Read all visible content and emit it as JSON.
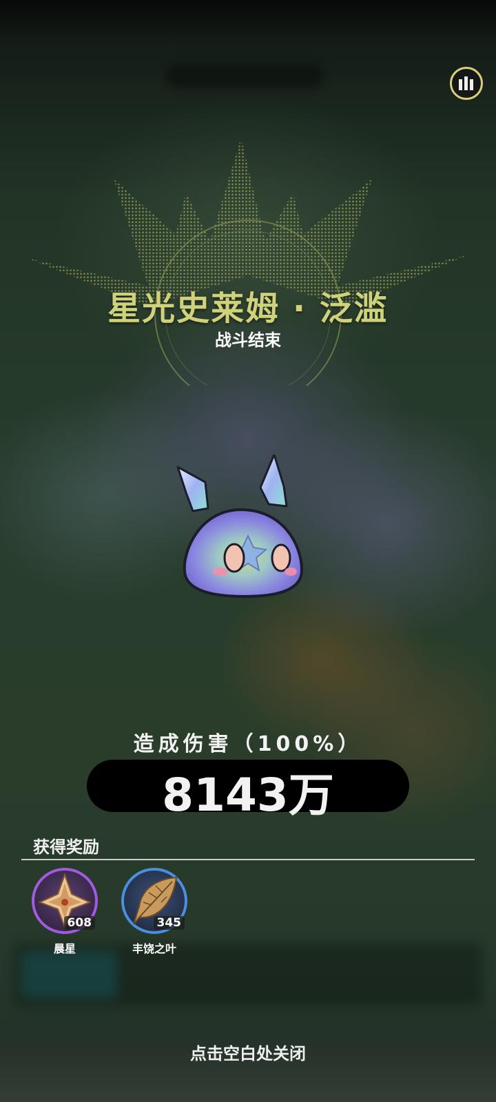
{
  "boss": {
    "title": "星光史莱姆 · 泛滥",
    "subtitle": "战斗结束"
  },
  "damage": {
    "label": "造成伤害（100%）",
    "value": "8143万",
    "percent": 100
  },
  "rewards": {
    "title": "获得奖励",
    "items": [
      {
        "name": "晨星",
        "count": "608",
        "icon": "morning-star-icon",
        "ring_color": "#a05be0"
      },
      {
        "name": "丰饶之叶",
        "count": "345",
        "icon": "leaf-icon",
        "ring_color": "#4a8fe0"
      }
    ]
  },
  "close_hint": "点击空白处关闭",
  "icons": {
    "stats": "bar-chart-icon"
  },
  "colors": {
    "title": "#cfd27b",
    "accent": "#d8cf7a"
  }
}
